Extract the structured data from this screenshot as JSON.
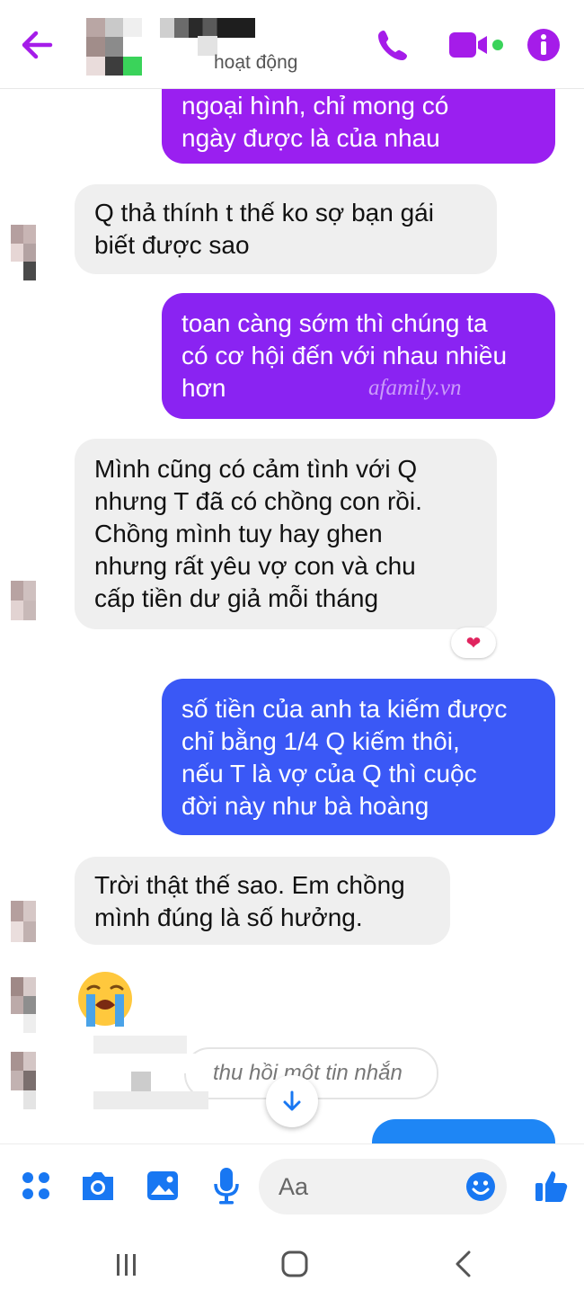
{
  "header": {
    "status_text": "hoạt động",
    "colors": {
      "accent": "#a51ce9",
      "online": "#3ad35a"
    },
    "icons": [
      "back-arrow-icon",
      "phone-icon",
      "video-camera-icon",
      "info-icon"
    ]
  },
  "messages": [
    {
      "dir": "out",
      "text": "ngoại hình, chỉ mong có\nngày được là của nhau",
      "color": "#9a1ff0"
    },
    {
      "dir": "in",
      "text": "Q thả thính t thế ko sợ bạn gái\nbiết được sao"
    },
    {
      "dir": "out",
      "text": "toan càng sớm thì chúng ta\ncó cơ hội đến với nhau nhiều\nhơn",
      "color": "#8a23f2"
    },
    {
      "dir": "in",
      "text": "Mình cũng có cảm tình với Q\nnhưng T đã có chồng con rồi.\nChồng mình tuy hay ghen\nnhưng rất yêu vợ con và chu\ncấp tiền dư giả mỗi tháng",
      "reaction": "heart"
    },
    {
      "dir": "out",
      "text": "số tiền của anh ta kiếm được\nchỉ bằng 1/4 Q kiếm thôi,\nnếu T là vợ của Q thì cuộc\nđời này như bà hoàng",
      "color": "#3a58f6"
    },
    {
      "dir": "in",
      "text": "Trời thật thế sao. Em chồng\nmình đúng là số hưởng."
    },
    {
      "dir": "in",
      "emoji": "loudly-crying-face"
    },
    {
      "dir": "in",
      "recalled_text": "thu hồi một tin nhắn"
    }
  ],
  "watermark": "afamily.vn",
  "composer": {
    "placeholder": "Aa",
    "icons": [
      "menu-dots-icon",
      "camera-icon",
      "image-icon",
      "microphone-icon",
      "emoji-icon",
      "thumbs-up-icon"
    ],
    "color": "#1877f2"
  },
  "navbar": {
    "icons": [
      "recent-apps-icon",
      "home-icon",
      "back-icon"
    ]
  }
}
